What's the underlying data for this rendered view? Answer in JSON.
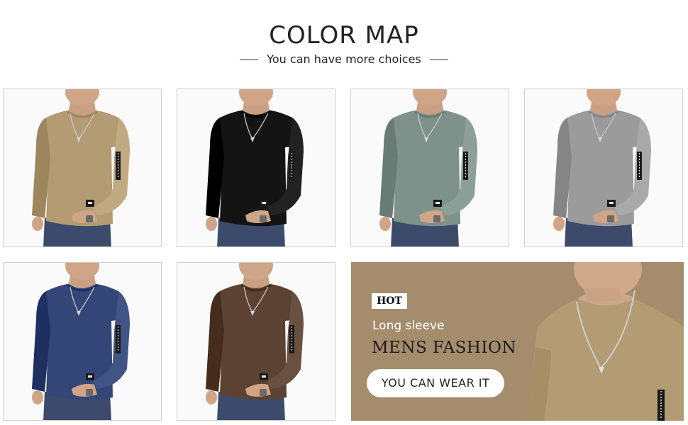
{
  "header": {
    "title": "COLOR MAP",
    "subtitle": "You can have more choices"
  },
  "swatches": [
    {
      "color": "#b39c73"
    },
    {
      "color": "#141414"
    },
    {
      "color": "#7f918b"
    },
    {
      "color": "#9b9b9b"
    },
    {
      "color": "#334677"
    },
    {
      "color": "#5b4232"
    }
  ],
  "promo": {
    "badge": "HOT",
    "line1": "Long sleeve",
    "line2": "MENS FASHION",
    "button": "YOU CAN WEAR IT",
    "background": "#a48c6d",
    "shirt_color": "#b39c73"
  }
}
